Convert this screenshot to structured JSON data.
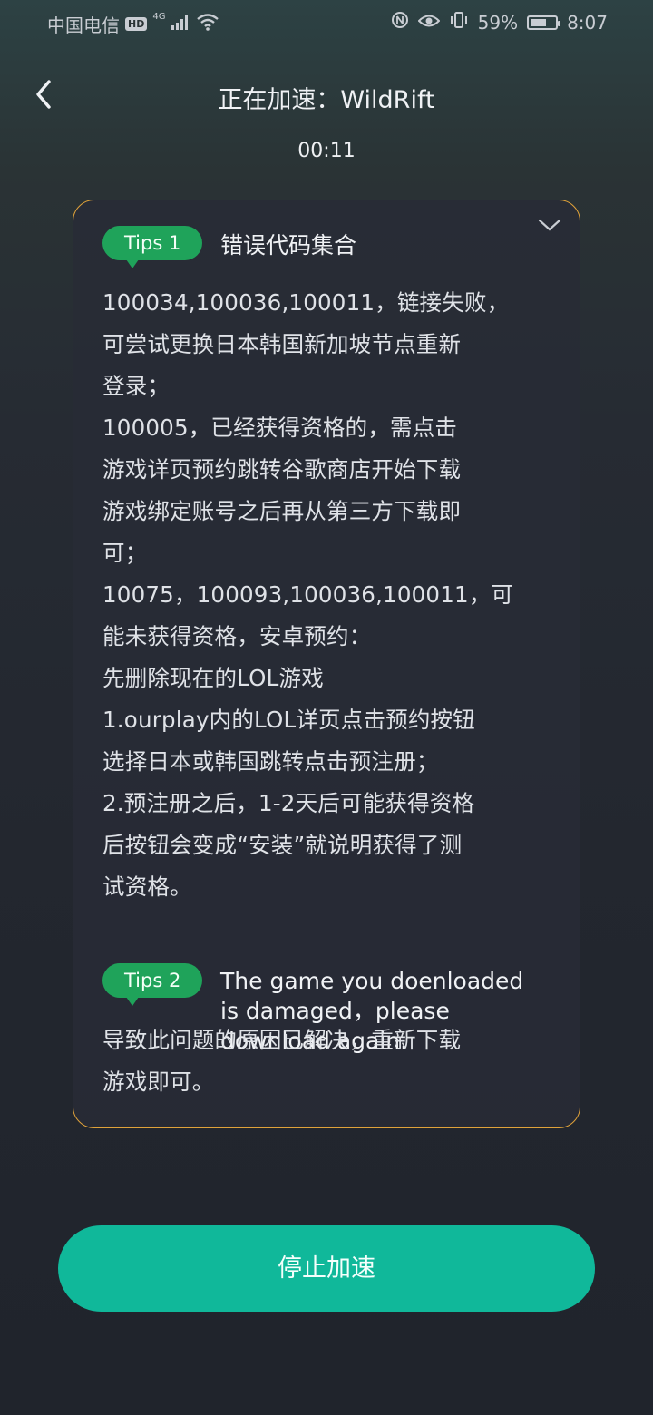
{
  "status_bar": {
    "carrier": "中国电信",
    "hd": "HD",
    "network": "4G",
    "battery_percent": "59%",
    "time": "8:07"
  },
  "header": {
    "title": "正在加速：WildRift",
    "timer": "00:11"
  },
  "tips": [
    {
      "badge": "Tips 1",
      "title": "错误代码集合",
      "body": "100034,100036,100011，链接失败，\n可尝试更换日本韩国新加坡节点重新\n登录；\n100005，已经获得资格的，需点击\n游戏详页预约跳转谷歌商店开始下载\n游戏绑定账号之后再从第三方下载即\n可；\n10075，100093,100036,100011，可\n能未获得资格，安卓预约：\n先删除现在的LOL游戏\n1.ourplay内的LOL详页点击预约按钮\n选择日本或韩国跳转点击预注册；\n2.预注册之后，1-2天后可能获得资格\n后按钮会变成“安装”就说明获得了测\n试资格。"
    },
    {
      "badge": "Tips 2",
      "title": "The game you doenloaded is damaged，please download again.",
      "body": "导致此问题的原因已解决，重新下载\n游戏即可。"
    }
  ],
  "footer": {
    "stop_label": "停止加速"
  },
  "colors": {
    "accent_green": "#1fa35a",
    "button_teal": "#10b89a",
    "card_border": "#e0a23a"
  },
  "icons": [
    "back-arrow-icon",
    "chevron-down-icon",
    "wifi-icon",
    "signal-icon",
    "battery-icon",
    "eye-icon",
    "vibrate-icon",
    "nfc-icon"
  ]
}
